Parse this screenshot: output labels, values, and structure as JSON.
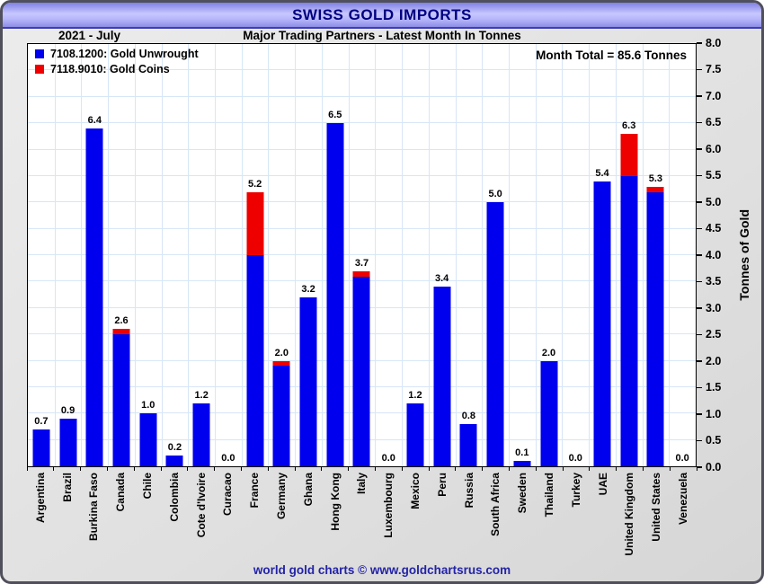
{
  "header": {
    "title_color": "#000080",
    "bar_gradient": [
      "#7f7fe4",
      "#c7c7ff",
      "#8d8de6"
    ]
  },
  "chart_data": {
    "type": "bar",
    "stacked": true,
    "title": "SWISS GOLD IMPORTS",
    "period": "2021 - July",
    "subtitle": "Major Trading Partners - Latest Month In Tonnes",
    "annotation": "Month Total = 85.6 Tonnes",
    "ylabel": "Tonnes of Gold",
    "ylim": [
      0,
      8
    ],
    "ytick_step": 0.5,
    "grid": true,
    "legend_position": "top-left-inside",
    "categories": [
      "Argentina",
      "Brazil",
      "Burkina Faso",
      "Canada",
      "Chile",
      "Colombia",
      "Cote d'Ivoire",
      "Curacao",
      "France",
      "Germany",
      "Ghana",
      "Hong Kong",
      "Italy",
      "Luxembourg",
      "Mexico",
      "Peru",
      "Russia",
      "South Africa",
      "Sweden",
      "Thailand",
      "Turkey",
      "UAE",
      "United Kingdom",
      "United States",
      "Venezuela"
    ],
    "series": [
      {
        "name": "7108.1200: Gold Unwrought",
        "color": "#0000ee",
        "values": [
          0.7,
          0.9,
          6.4,
          2.5,
          1.0,
          0.2,
          1.2,
          0.0,
          4.0,
          1.9,
          3.2,
          6.5,
          3.6,
          0.0,
          1.2,
          3.4,
          0.8,
          5.0,
          0.1,
          2.0,
          0.0,
          5.4,
          5.5,
          5.2,
          0.0
        ]
      },
      {
        "name": "7118.9010: Gold Coins",
        "color": "#ee0000",
        "values": [
          0,
          0,
          0,
          0.1,
          0,
          0,
          0,
          0,
          1.2,
          0.1,
          0,
          0,
          0.1,
          0,
          0,
          0,
          0,
          0,
          0,
          0,
          0,
          0,
          0.8,
          0.1,
          0
        ]
      }
    ],
    "bar_total_labels": [
      "0.7",
      "0.9",
      "6.4",
      "2.6",
      "1.0",
      "0.2",
      "1.2",
      "0.0",
      "5.2",
      "2.0",
      "3.2",
      "6.5",
      "3.7",
      "0.0",
      "1.2",
      "3.4",
      "0.8",
      "5.0",
      "0.1",
      "2.0",
      "0.0",
      "5.4",
      "6.3",
      "5.3",
      "0.0"
    ]
  },
  "colors": {
    "gridline": "#d7e6f6",
    "plot_background": "#ffffff",
    "plot_border": "#000000",
    "frame_background": "#e3e3e3",
    "frame_border": "#50505c",
    "footer_text": "#2323a8"
  },
  "footer": {
    "text": "world gold charts © www.goldchartsrus.com"
  }
}
